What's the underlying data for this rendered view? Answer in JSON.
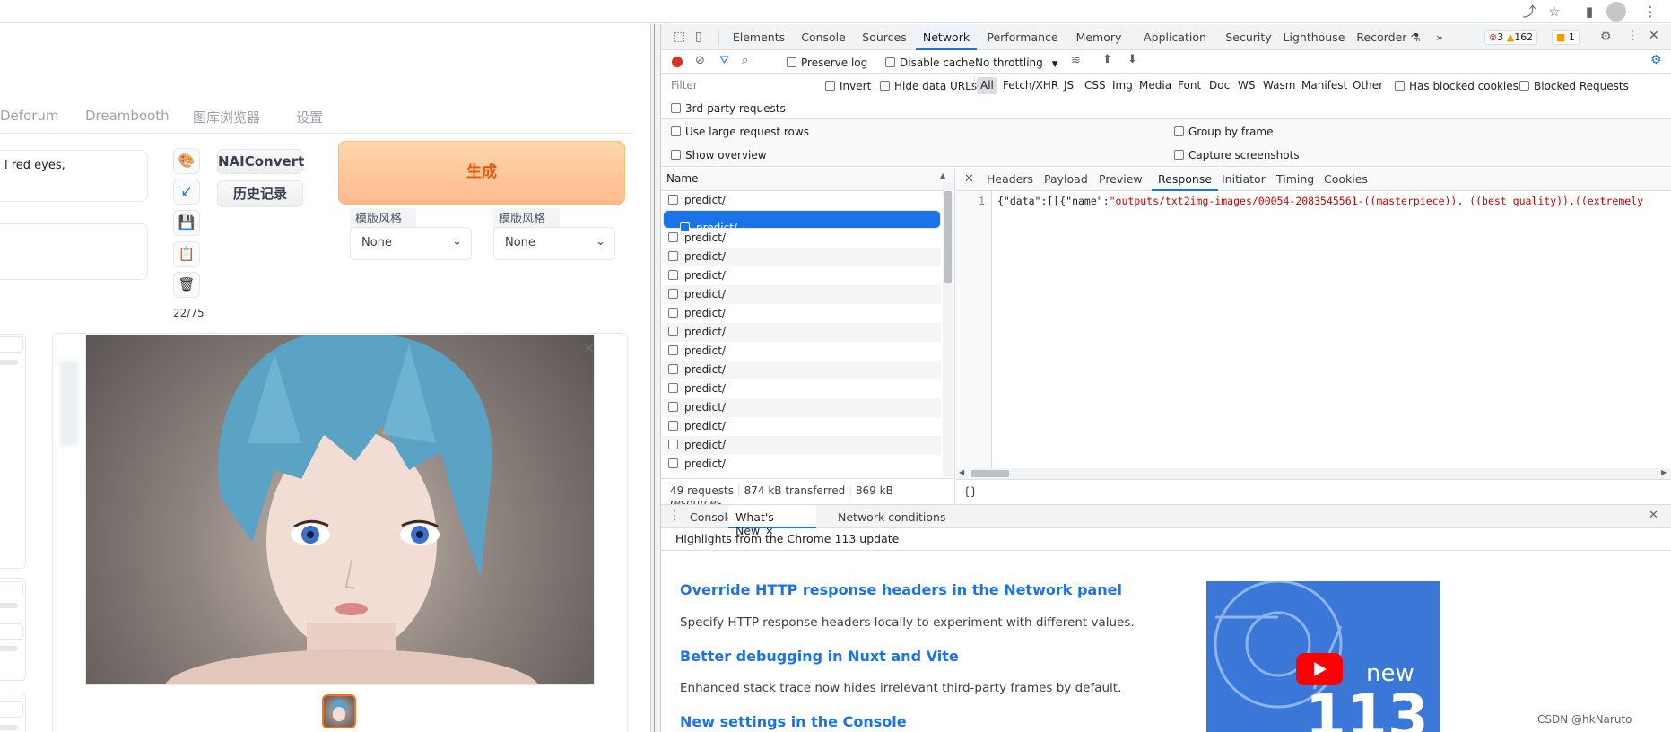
{
  "browser": {
    "toolbar_icons": [
      "share-icon",
      "star-icon",
      "side-panel-icon",
      "profile-icon",
      "menu-icon"
    ]
  },
  "webui": {
    "tabs": [
      "Deforum",
      "Dreambooth",
      "图库浏览器",
      "设置"
    ],
    "prompt_text": "l red eyes,",
    "token_count": "22/75",
    "nai_button": "NAIConvert",
    "history_button": "历史记录",
    "generate_button": "生成",
    "style1_label": "模版风格 1",
    "style2_label": "模版风格 2",
    "style1_value": "None",
    "style2_value": "None",
    "close_symbol": "×",
    "tool_icons": [
      "palette-icon",
      "arrow-icon",
      "save-icon",
      "clipboard-icon",
      "trash-icon"
    ],
    "colors": {
      "generate_bg": "#fdba8c",
      "generate_text": "#ea580c"
    }
  },
  "devtools": {
    "tabs": [
      "Elements",
      "Console",
      "Sources",
      "Network",
      "Performance",
      "Memory",
      "Application",
      "Security",
      "Lighthouse",
      "Recorder ⚗",
      "»"
    ],
    "active_tab": "Network",
    "errors": "3",
    "warnings": "162",
    "issues": "1",
    "toolbar": {
      "preserve_log": "Preserve log",
      "disable_cache": "Disable cache",
      "throttling": "No throttling"
    },
    "filter": {
      "placeholder": "Filter",
      "invert": "Invert",
      "hide_data_urls": "Hide data URLs",
      "types": [
        "All",
        "Fetch/XHR",
        "JS",
        "CSS",
        "Img",
        "Media",
        "Font",
        "Doc",
        "WS",
        "Wasm",
        "Manifest",
        "Other"
      ],
      "has_blocked_cookies": "Has blocked cookies",
      "blocked_requests": "Blocked Requests",
      "third_party": "3rd-party requests"
    },
    "options": {
      "large_rows": "Use large request rows",
      "group_by_frame": "Group by frame",
      "show_overview": "Show overview",
      "capture_screenshots": "Capture screenshots"
    },
    "name_header": "Name",
    "requests": [
      "predict/",
      "predict/",
      "predict/",
      "predict/",
      "predict/",
      "predict/",
      "predict/",
      "predict/",
      "predict/",
      "predict/",
      "predict/",
      "predict/",
      "predict/",
      "predict/",
      "predict/"
    ],
    "selected_index": 1,
    "detail_tabs": [
      "Headers",
      "Payload",
      "Preview",
      "Response",
      "Initiator",
      "Timing",
      "Cookies"
    ],
    "active_detail_tab": "Response",
    "response_line_no": "1",
    "response_prefix": "{\"data\":[[{\"name\":",
    "response_string": "\"outputs/txt2img-images/00054-2083545561-((masterpiece)), ((best quality)),((extremely",
    "status": {
      "requests": "49 requests",
      "transferred": "874 kB transferred",
      "resources": "869 kB resources",
      "format": "{}"
    },
    "drawer": {
      "tabs": [
        "Console",
        "What's New",
        "Network conditions"
      ],
      "active": "What's New",
      "highlight": "Highlights from the Chrome 113 update",
      "items": [
        {
          "title": "Override HTTP response headers in the Network panel",
          "desc": "Specify HTTP response headers locally to experiment with different values."
        },
        {
          "title": "Better debugging in Nuxt and Vite",
          "desc": "Enhanced stack trace now hides irrelevant third-party frames by default."
        },
        {
          "title": "New settings in the Console",
          "desc": ""
        }
      ],
      "video_text_new": "new",
      "video_text_num": "113"
    }
  },
  "watermark": "CSDN @hkNaruto"
}
